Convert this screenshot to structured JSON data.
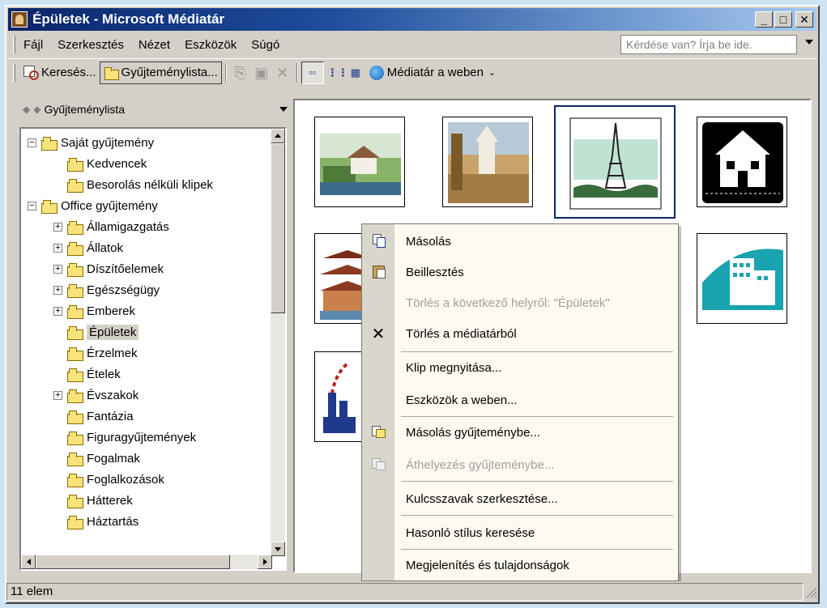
{
  "window": {
    "title": "Épületek - Microsoft Médiatár"
  },
  "menubar": {
    "items": [
      "Fájl",
      "Szerkesztés",
      "Nézet",
      "Eszközök",
      "Súgó"
    ],
    "help_box": "Kérdése van? Írja be ide."
  },
  "toolbar": {
    "search_label": "Keresés...",
    "collection_list_label": "Gyűjteménylista...",
    "web_label": "Médiatár a weben"
  },
  "left_pane": {
    "header": "Gyűjteménylista",
    "tree": [
      {
        "label": "Saját gyűjtemény",
        "level": 0,
        "expander": "−"
      },
      {
        "label": "Kedvencek",
        "level": 1,
        "expander": ""
      },
      {
        "label": "Besorolás nélküli klipek",
        "level": 1,
        "expander": ""
      },
      {
        "label": "Office gyűjtemény",
        "level": 0,
        "expander": "−"
      },
      {
        "label": "Államigazgatás",
        "level": 1,
        "expander": "+"
      },
      {
        "label": "Állatok",
        "level": 1,
        "expander": "+"
      },
      {
        "label": "Díszítőelemek",
        "level": 1,
        "expander": "+"
      },
      {
        "label": "Egészségügy",
        "level": 1,
        "expander": "+"
      },
      {
        "label": "Emberek",
        "level": 1,
        "expander": "+"
      },
      {
        "label": "Épületek",
        "level": 1,
        "expander": "",
        "selected": true
      },
      {
        "label": "Érzelmek",
        "level": 1,
        "expander": ""
      },
      {
        "label": "Ételek",
        "level": 1,
        "expander": ""
      },
      {
        "label": "Évszakok",
        "level": 1,
        "expander": "+"
      },
      {
        "label": "Fantázia",
        "level": 1,
        "expander": ""
      },
      {
        "label": "Figuragyűjtemények",
        "level": 1,
        "expander": ""
      },
      {
        "label": "Fogalmak",
        "level": 1,
        "expander": ""
      },
      {
        "label": "Foglalkozások",
        "level": 1,
        "expander": ""
      },
      {
        "label": "Hátterek",
        "level": 1,
        "expander": ""
      },
      {
        "label": "Háztartás",
        "level": 1,
        "expander": ""
      }
    ]
  },
  "context_menu": {
    "items": [
      {
        "label": "Másolás",
        "icon": "copy-icon",
        "disabled": false
      },
      {
        "label": "Beillesztés",
        "icon": "paste-icon",
        "disabled": false
      },
      {
        "label": "Törlés a következő helyről: \"Épületek\"",
        "icon": "",
        "disabled": true
      },
      {
        "label": "Törlés a médiatárból",
        "icon": "delete-icon",
        "disabled": false
      },
      {
        "label": "Klip megnyitása...",
        "icon": "",
        "disabled": false
      },
      {
        "label": "Eszközök a weben...",
        "icon": "",
        "disabled": false
      },
      {
        "label": "Másolás gyűjteménybe...",
        "icon": "copy-to-collection-icon",
        "disabled": false
      },
      {
        "label": "Áthelyezés gyűjteménybe...",
        "icon": "move-to-collection-icon",
        "disabled": true
      },
      {
        "label": "Kulcsszavak szerkesztése...",
        "icon": "",
        "disabled": false
      },
      {
        "label": "Hasonló stílus keresése",
        "icon": "",
        "disabled": false
      },
      {
        "label": "Megjelenítés és tulajdonságok",
        "icon": "",
        "disabled": false
      }
    ]
  },
  "statusbar": {
    "text": "11 elem"
  },
  "colors": {
    "title_start": "#0a246a",
    "title_end": "#a6caf0",
    "face": "#d4d0c8",
    "menu_bg": "#fffaf0"
  }
}
